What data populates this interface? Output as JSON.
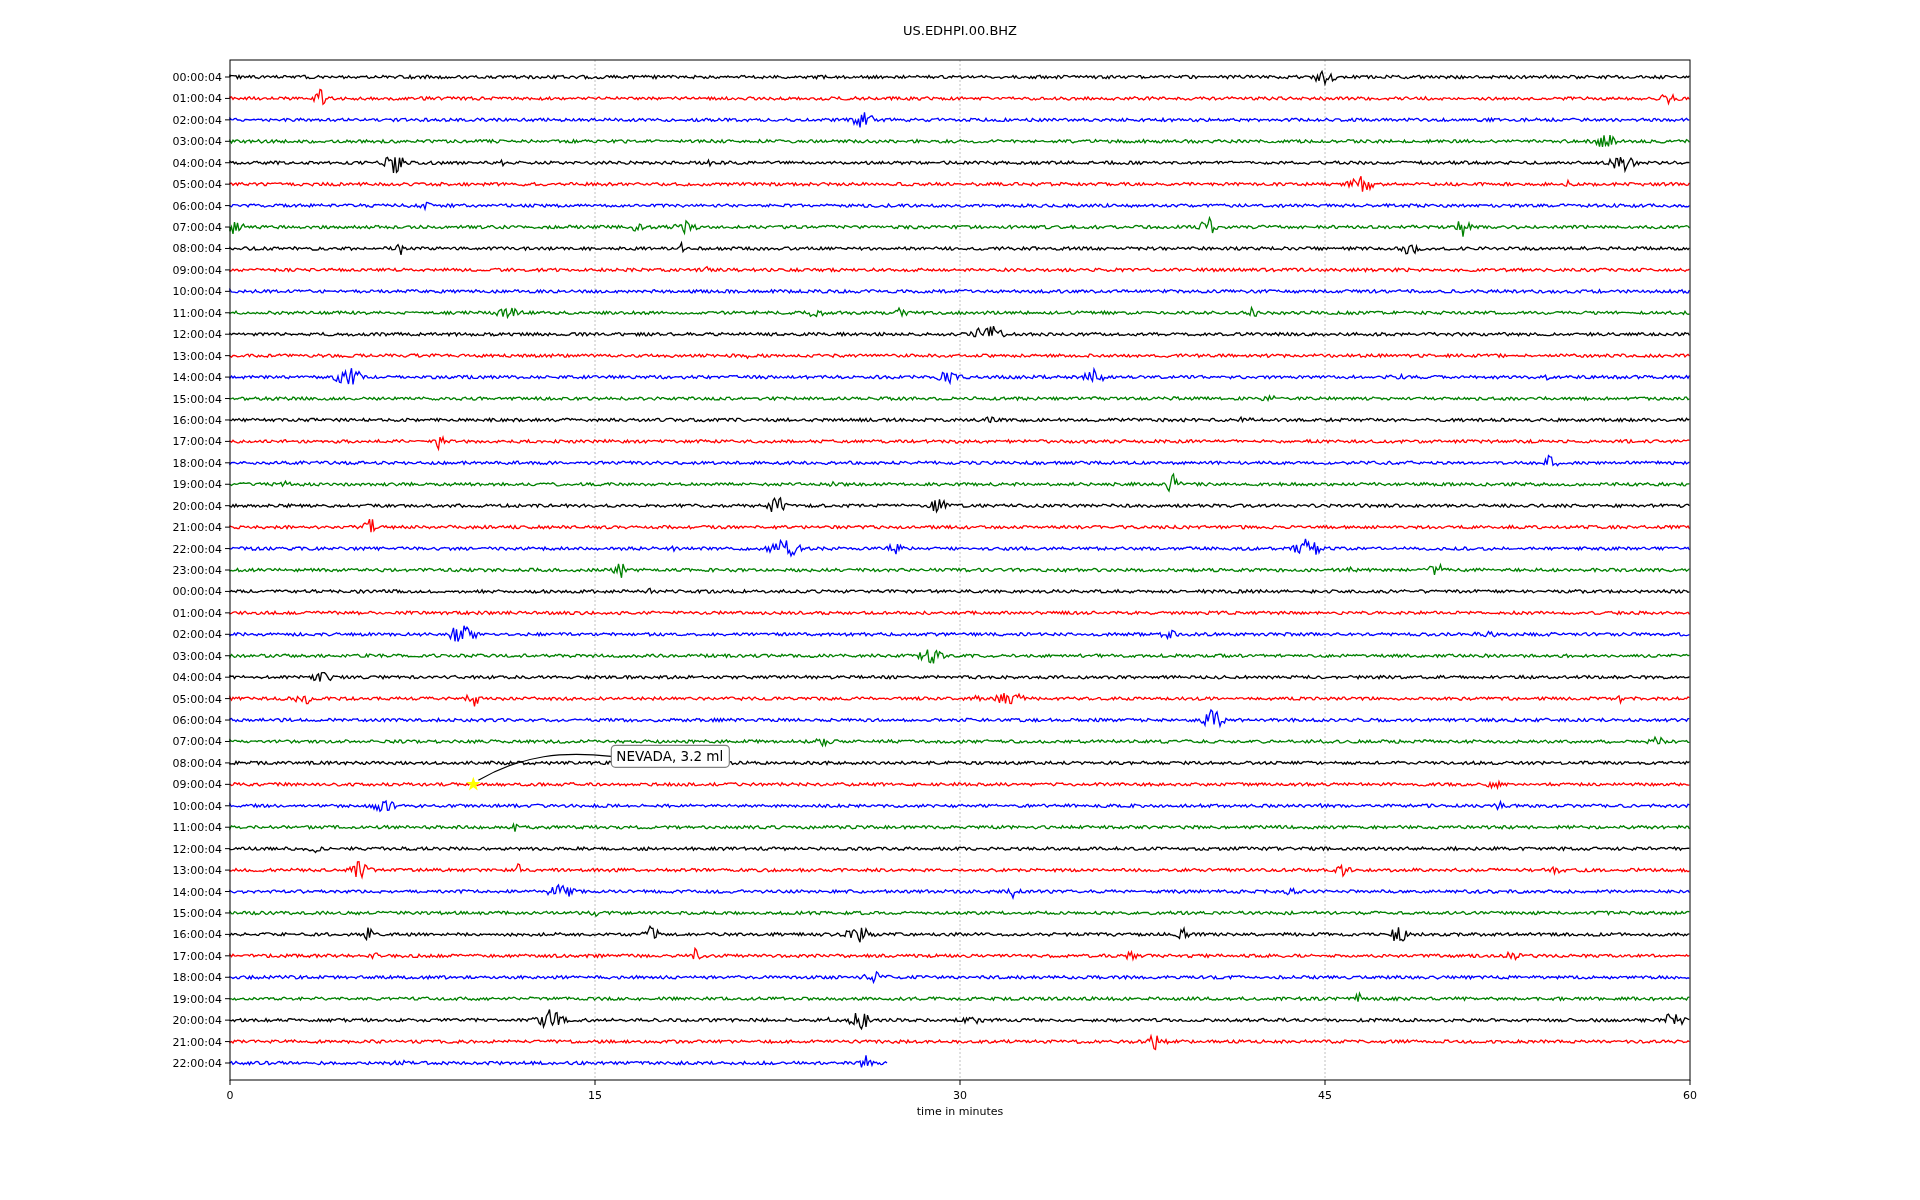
{
  "title": "US.EDHPI.00.BHZ",
  "rows": [
    {
      "label": "00:00:04",
      "color": "#000000",
      "level": 1
    },
    {
      "label": "01:00:04",
      "color": "#ff0000",
      "level": 1
    },
    {
      "label": "02:00:04",
      "color": "#0000ff",
      "level": 1
    },
    {
      "label": "03:00:04",
      "color": "#008000",
      "level": 1
    },
    {
      "label": "04:00:04",
      "color": "#000000",
      "level": 1
    },
    {
      "label": "05:00:04",
      "color": "#ff0000",
      "level": 1
    },
    {
      "label": "06:00:04",
      "color": "#0000ff",
      "level": 1
    },
    {
      "label": "07:00:04",
      "color": "#008000",
      "level": 1
    },
    {
      "label": "08:00:04",
      "color": "#000000",
      "level": 1
    },
    {
      "label": "09:00:04",
      "color": "#ff0000",
      "level": 1
    },
    {
      "label": "10:00:04",
      "color": "#0000ff",
      "level": 1
    },
    {
      "label": "11:00:04",
      "color": "#008000",
      "level": 1
    },
    {
      "label": "12:00:04",
      "color": "#000000",
      "level": 1
    },
    {
      "label": "13:00:04",
      "color": "#ff0000",
      "level": 1
    },
    {
      "label": "14:00:04",
      "color": "#0000ff",
      "level": 1
    },
    {
      "label": "15:00:04",
      "color": "#008000",
      "level": 1
    },
    {
      "label": "16:00:04",
      "color": "#000000",
      "level": 1
    },
    {
      "label": "17:00:04",
      "color": "#ff0000",
      "level": 1
    },
    {
      "label": "18:00:04",
      "color": "#0000ff",
      "level": 1
    },
    {
      "label": "19:00:04",
      "color": "#008000",
      "level": 1
    },
    {
      "label": "20:00:04",
      "color": "#000000",
      "level": 1
    },
    {
      "label": "21:00:04",
      "color": "#ff0000",
      "level": 1
    },
    {
      "label": "22:00:04",
      "color": "#0000ff",
      "level": 1
    },
    {
      "label": "23:00:04",
      "color": "#008000",
      "level": 1
    },
    {
      "label": "00:00:04",
      "color": "#000000",
      "level": 1
    },
    {
      "label": "01:00:04",
      "color": "#ff0000",
      "level": 1
    },
    {
      "label": "02:00:04",
      "color": "#0000ff",
      "level": 1
    },
    {
      "label": "03:00:04",
      "color": "#008000",
      "level": 1
    },
    {
      "label": "04:00:04",
      "color": "#000000",
      "level": 1
    },
    {
      "label": "05:00:04",
      "color": "#ff0000",
      "level": 1
    },
    {
      "label": "06:00:04",
      "color": "#0000ff",
      "level": 1
    },
    {
      "label": "07:00:04",
      "color": "#008000",
      "level": 1
    },
    {
      "label": "08:00:04",
      "color": "#000000",
      "level": 1
    },
    {
      "label": "09:00:04",
      "color": "#ff0000",
      "level": 1,
      "event": {
        "label": "NEVADA, 3.2 ml"
      }
    },
    {
      "label": "10:00:04",
      "color": "#0000ff",
      "level": 1
    },
    {
      "label": "11:00:04",
      "color": "#008000",
      "level": 1
    },
    {
      "label": "12:00:04",
      "color": "#000000",
      "level": 1
    },
    {
      "label": "13:00:04",
      "color": "#ff0000",
      "level": 1
    },
    {
      "label": "14:00:04",
      "color": "#0000ff",
      "level": 1
    },
    {
      "label": "15:00:04",
      "color": "#008000",
      "level": 1
    },
    {
      "label": "16:00:04",
      "color": "#000000",
      "level": 1
    },
    {
      "label": "17:00:04",
      "color": "#ff0000",
      "level": 1
    },
    {
      "label": "18:00:04",
      "color": "#0000ff",
      "level": 1
    },
    {
      "label": "19:00:04",
      "color": "#008000",
      "level": 1
    },
    {
      "label": "20:00:04",
      "color": "#000000",
      "level": 1
    },
    {
      "label": "21:00:04",
      "color": "#ff0000",
      "level": 1
    },
    {
      "label": "22:00:04",
      "color": "#0000ff",
      "level": 0.45
    }
  ],
  "x_axis": {
    "ticks": [
      "0",
      "15",
      "30",
      "45",
      "60"
    ],
    "label": "time in minutes"
  }
}
